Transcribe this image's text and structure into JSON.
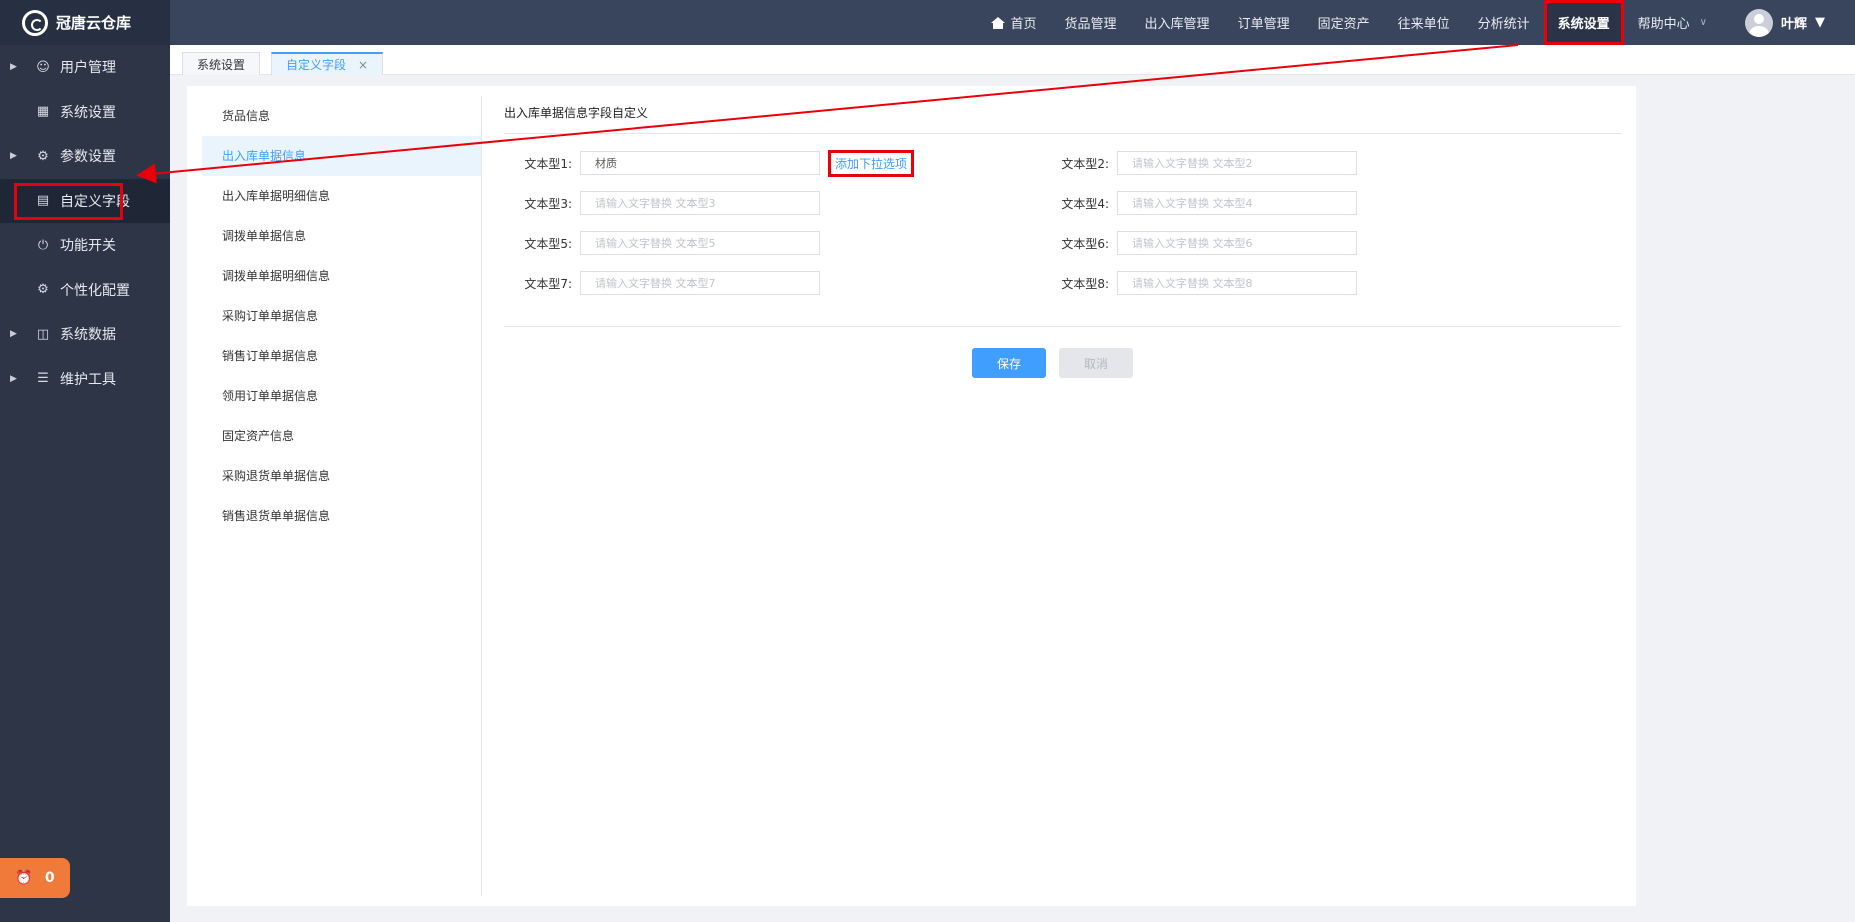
{
  "app": {
    "name": "冠唐云仓库"
  },
  "sidebar": {
    "items": [
      {
        "label": "用户管理",
        "icon": "user-icon",
        "caret": true
      },
      {
        "label": "系统设置",
        "icon": "monitor-icon",
        "caret": false
      },
      {
        "label": "参数设置",
        "icon": "gear-icon",
        "caret": true
      },
      {
        "label": "自定义字段",
        "icon": "form-icon",
        "caret": false,
        "active": true
      },
      {
        "label": "功能开关",
        "icon": "power-icon",
        "caret": false
      },
      {
        "label": "个性化配置",
        "icon": "gear-icon",
        "caret": false
      },
      {
        "label": "系统数据",
        "icon": "chart-icon",
        "caret": true
      },
      {
        "label": "维护工具",
        "icon": "database-icon",
        "caret": true
      }
    ],
    "fab_count": "0"
  },
  "topnav": {
    "items": [
      "首页",
      "货品管理",
      "出入库管理",
      "订单管理",
      "固定资产",
      "往来单位",
      "分析统计",
      "系统设置",
      "帮助中心"
    ],
    "active": "系统设置",
    "user_name": "叶辉"
  },
  "tabs": [
    {
      "label": "系统设置",
      "active": false
    },
    {
      "label": "自定义字段",
      "active": true,
      "close": "×"
    }
  ],
  "subnav": [
    "货品信息",
    "出入库单据信息",
    "出入库单据明细信息",
    "调拨单单据信息",
    "调拨单单据明细信息",
    "采购订单单据信息",
    "销售订单单据信息",
    "领用订单单据信息",
    "固定资产信息",
    "采购退货单单据信息",
    "销售退货单单据信息"
  ],
  "subnav_active": "出入库单据信息",
  "form": {
    "title": "出入库单据信息字段自定义",
    "fields": [
      {
        "label": "文本型1:",
        "value": "材质",
        "placeholder": ""
      },
      {
        "label": "文本型2:",
        "value": "",
        "placeholder": "请输入文字替换 文本型2"
      },
      {
        "label": "文本型3:",
        "value": "",
        "placeholder": "请输入文字替换 文本型3"
      },
      {
        "label": "文本型4:",
        "value": "",
        "placeholder": "请输入文字替换 文本型4"
      },
      {
        "label": "文本型5:",
        "value": "",
        "placeholder": "请输入文字替换 文本型5"
      },
      {
        "label": "文本型6:",
        "value": "",
        "placeholder": "请输入文字替换 文本型6"
      },
      {
        "label": "文本型7:",
        "value": "",
        "placeholder": "请输入文字替换 文本型7"
      },
      {
        "label": "文本型8:",
        "value": "",
        "placeholder": "请输入文字替换 文本型8"
      }
    ],
    "add_option_link": "添加下拉选项",
    "save_label": "保存",
    "cancel_label": "取消"
  },
  "colors": {
    "accent": "#409eff",
    "highlight": "#e8000b",
    "sidebar": "#2d3547",
    "topbar": "#39455c"
  }
}
